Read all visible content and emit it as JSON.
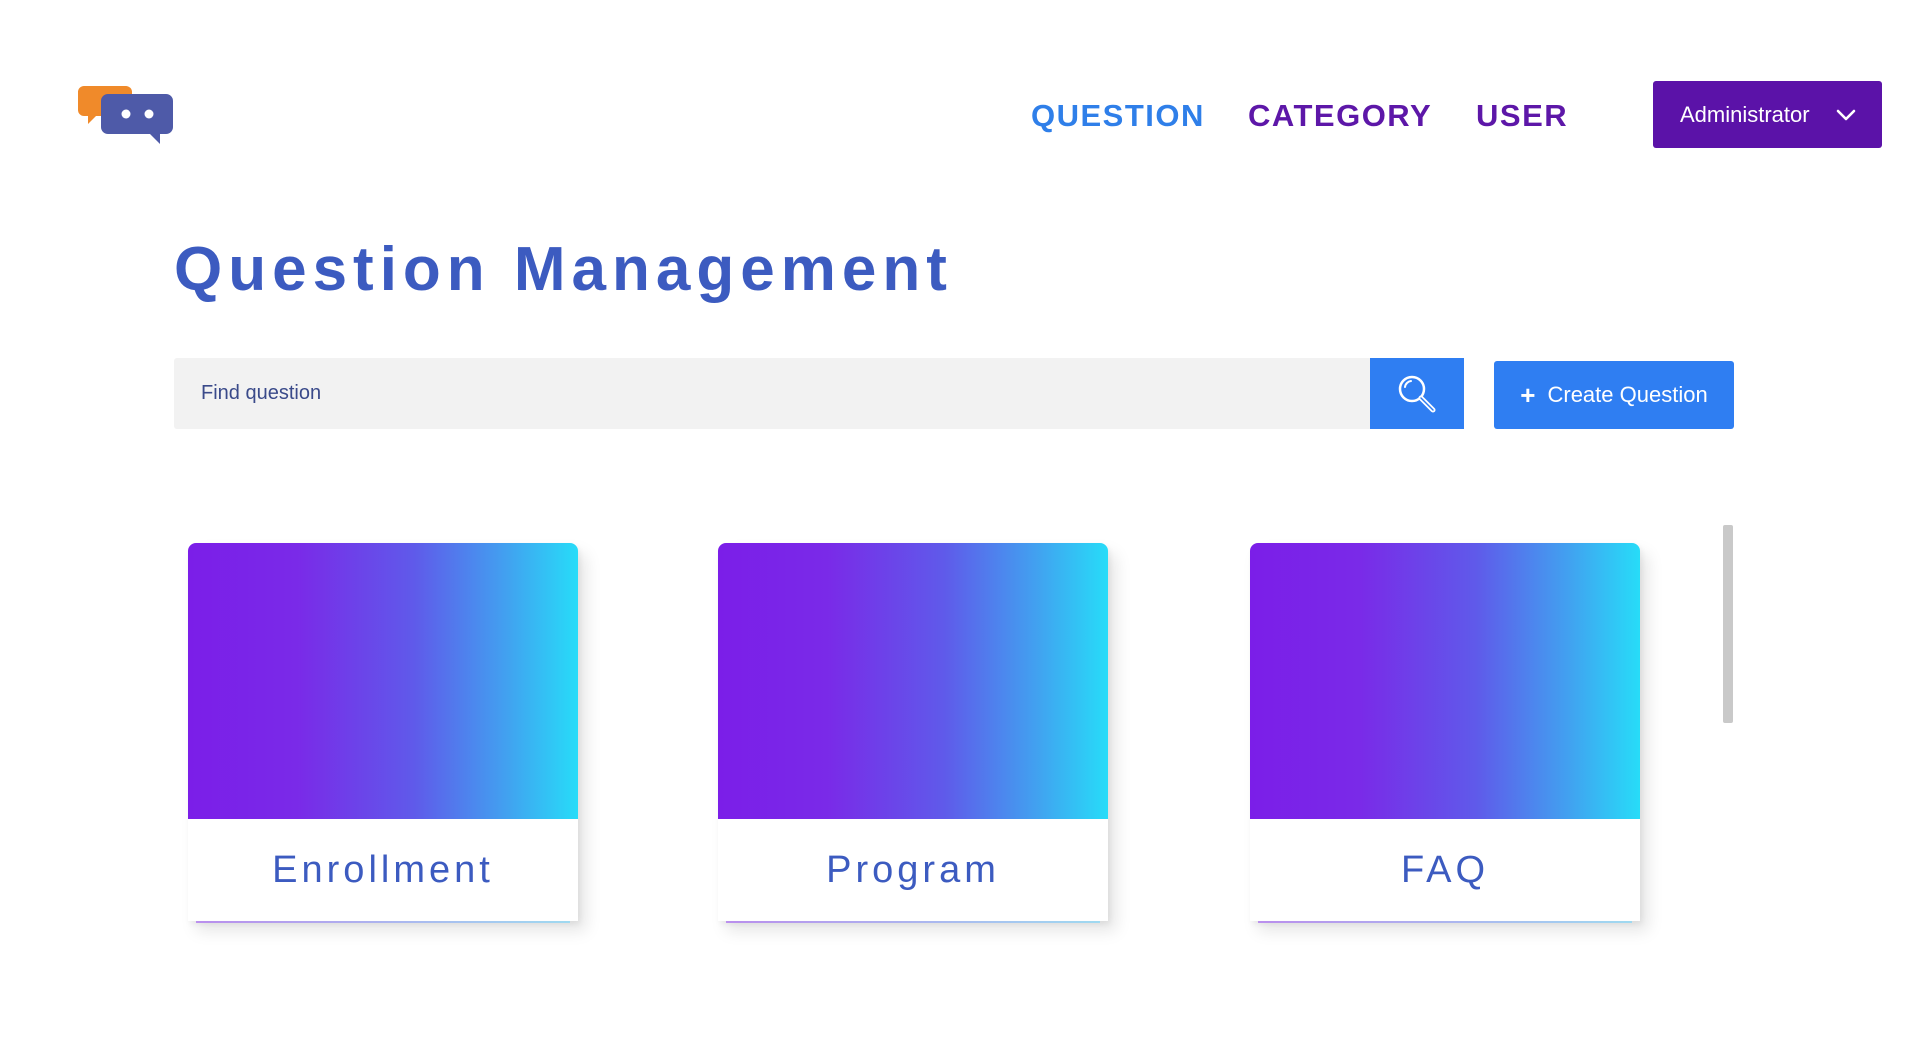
{
  "nav": {
    "items": [
      {
        "label": "QUESTION"
      },
      {
        "label": "CATEGORY"
      },
      {
        "label": "USER"
      }
    ],
    "account_label": "Administrator",
    "active_color": "#2f7fe9",
    "inactive_color": "#5d17a8"
  },
  "page_title": "Question Management",
  "search": {
    "placeholder": "Find question",
    "value": "",
    "button_icon": "search-icon"
  },
  "create_button": {
    "label": "Create Question",
    "icon": "plus-icon"
  },
  "categories": [
    {
      "label": "Enrollment"
    },
    {
      "label": "Program"
    },
    {
      "label": "FAQ"
    }
  ],
  "colors": {
    "brand_purple": "#5b12a8",
    "primary_blue": "#2f7ef2",
    "title_blue": "#3c5bc0",
    "gradient_start": "#7b1ee8",
    "gradient_end": "#27dcf8"
  }
}
